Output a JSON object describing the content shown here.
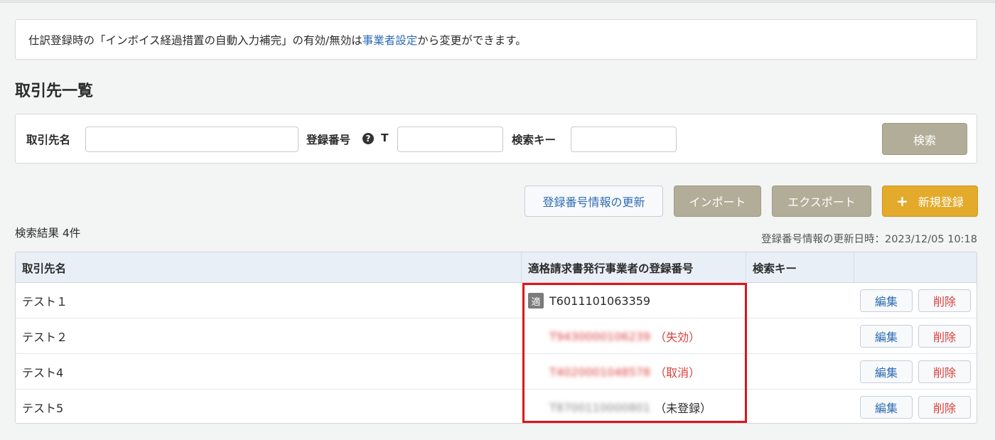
{
  "notice": {
    "prefix": "仕訳登録時の「インボイス経過措置の自動入力補完」の有効/無効は",
    "link": "事業者設定",
    "suffix": "から変更ができます。"
  },
  "page_title": "取引先一覧",
  "search": {
    "name_label": "取引先名",
    "name_value": "",
    "reg_label": "登録番号",
    "reg_prefix": "T",
    "reg_value": "",
    "key_label": "検索キー",
    "key_value": "",
    "search_button": "検索"
  },
  "actions": {
    "update_reg": "登録番号情報の更新",
    "import": "インポート",
    "export": "エクスポート",
    "new": "新規登録"
  },
  "result_count": "検索結果 4件",
  "updated_at": "登録番号情報の更新日時：2023/12/05 10:18",
  "table": {
    "headers": [
      "取引先名",
      "適格請求書発行事業者の登録番号",
      "検索キー",
      ""
    ],
    "badge": "適",
    "edit_label": "編集",
    "delete_label": "削除",
    "rows": [
      {
        "name": "テスト１",
        "reg_no": "T6011101063359",
        "status": "",
        "search_key": ""
      },
      {
        "name": "テスト２",
        "reg_no": "T9430000106239",
        "status": "（失効）",
        "search_key": ""
      },
      {
        "name": "テスト4",
        "reg_no": "T4020001048578",
        "status": "（取消）",
        "search_key": ""
      },
      {
        "name": "テスト5",
        "reg_no": "T8700110000801",
        "status": "（未登録）",
        "search_key": ""
      }
    ]
  },
  "colors": {
    "accent_link": "#2f6db5",
    "primary_button": "#e3aa2b",
    "secondary_button": "#b2ad98",
    "danger": "#d9413c",
    "highlight": "#e0141a"
  }
}
